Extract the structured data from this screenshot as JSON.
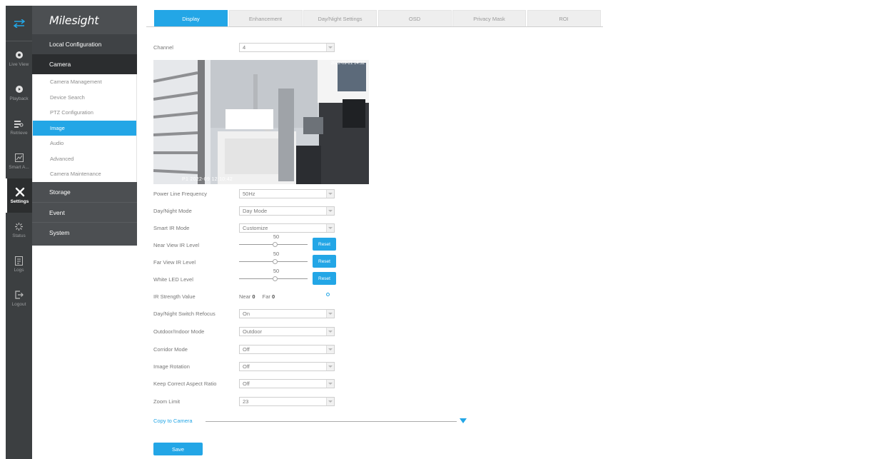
{
  "app": {
    "brand": "Milesight"
  },
  "rail": {
    "items": [
      {
        "label": "Live View",
        "icon": "live-view-icon"
      },
      {
        "label": "Playback",
        "icon": "playback-icon"
      },
      {
        "label": "Retrieve",
        "icon": "retrieve-icon"
      },
      {
        "label": "Smart A...",
        "icon": "smart-analysis-icon"
      },
      {
        "label": "Settings",
        "icon": "settings-icon",
        "active": true
      },
      {
        "label": "Status",
        "icon": "status-icon"
      },
      {
        "label": "Logs",
        "icon": "logs-icon"
      },
      {
        "label": "Logout",
        "icon": "logout-icon"
      }
    ]
  },
  "menu": {
    "local_configuration": "Local Configuration",
    "camera": "Camera",
    "camera_items": [
      "Camera Management",
      "Device Search",
      "PTZ Configuration",
      "Image",
      "Audio",
      "Advanced",
      "Camera Maintenance"
    ],
    "active_camera_item": "Image",
    "storage": "Storage",
    "event": "Event",
    "system": "System"
  },
  "tabs": [
    "Display",
    "Enhancement",
    "Day/Night Settings",
    "OSD",
    "Privacy Mask",
    "ROI"
  ],
  "active_tab": "Display",
  "form": {
    "channel": {
      "label": "Channel",
      "value": "4"
    },
    "preview": {
      "osd_text": "P1 2022-09 12:10:42",
      "top_osd": "2022-09-21 14:32"
    },
    "power_line_frequency": {
      "label": "Power Line Frequency",
      "value": "50Hz"
    },
    "day_night_mode": {
      "label": "Day/Night Mode",
      "value": "Day Mode"
    },
    "smart_ir_mode": {
      "label": "Smart IR Mode",
      "value": "Customize"
    },
    "near_view_ir_level": {
      "label": "Near View IR Level",
      "value": "50",
      "reset": "Reset"
    },
    "far_view_ir_level": {
      "label": "Far View IR Level",
      "value": "50",
      "reset": "Reset"
    },
    "white_led_level": {
      "label": "White LED Level",
      "value": "50",
      "reset": "Reset"
    },
    "ir_strength": {
      "label": "IR Strength Value",
      "near_label": "Near",
      "near_value": "0",
      "far_label": "Far",
      "far_value": "0"
    },
    "day_night_switch_refocus": {
      "label": "Day/Night Switch Refocus",
      "value": "On"
    },
    "outdoor_indoor_mode": {
      "label": "Outdoor/Indoor Mode",
      "value": "Outdoor"
    },
    "corridor_mode": {
      "label": "Corridor Mode",
      "value": "Off"
    },
    "image_rotation": {
      "label": "Image Rotation",
      "value": "Off"
    },
    "keep_correct_aspect_ratio": {
      "label": "Keep Correct Aspect Ratio",
      "value": "Off"
    },
    "zoom_limit": {
      "label": "Zoom Limit",
      "value": "23"
    },
    "copy_to_camera": "Copy to Camera",
    "save": "Save"
  },
  "colors": {
    "accent": "#23a6e6",
    "rail": "#3c3f41",
    "menu": "#4c4f52"
  }
}
